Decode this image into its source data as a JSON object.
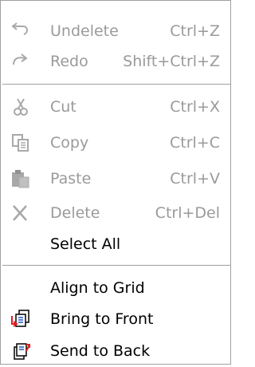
{
  "menu": {
    "items": [
      {
        "label": "Undelete",
        "shortcut": "Ctrl+Z",
        "icon": "undelete-icon",
        "enabled": false
      },
      {
        "label": "Redo",
        "shortcut": "Shift+Ctrl+Z",
        "icon": "redo-icon",
        "enabled": false
      },
      {
        "label": "Cut",
        "shortcut": "Ctrl+X",
        "icon": "scissors-icon",
        "enabled": false
      },
      {
        "label": "Copy",
        "shortcut": "Ctrl+C",
        "icon": "copy-icon",
        "enabled": false
      },
      {
        "label": "Paste",
        "shortcut": "Ctrl+V",
        "icon": "paste-icon",
        "enabled": false
      },
      {
        "label": "Delete",
        "shortcut": "Ctrl+Del",
        "icon": "delete-icon",
        "enabled": false
      },
      {
        "label": "Select All",
        "shortcut": "",
        "icon": "",
        "enabled": true
      },
      {
        "label": "Align to Grid",
        "shortcut": "",
        "icon": "",
        "enabled": true
      },
      {
        "label": "Bring to Front",
        "shortcut": "",
        "icon": "bring-to-front-icon",
        "enabled": true
      },
      {
        "label": "Send to Back",
        "shortcut": "",
        "icon": "send-to-back-icon",
        "enabled": true
      }
    ]
  },
  "colors": {
    "disabled_text": "#9a9a9a",
    "enabled_text": "#000000",
    "separator": "#a0a0a0",
    "accent_red": "#e02020"
  }
}
